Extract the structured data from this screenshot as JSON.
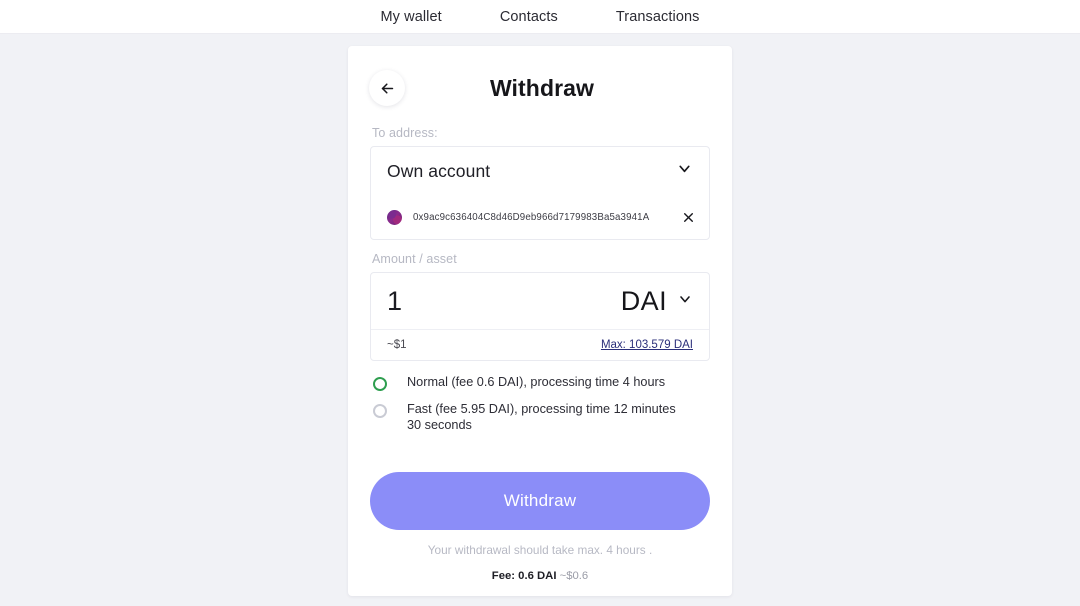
{
  "nav": {
    "items": [
      {
        "label": "My wallet"
      },
      {
        "label": "Contacts"
      },
      {
        "label": "Transactions"
      }
    ]
  },
  "card": {
    "back_icon": "arrow-left-icon",
    "title": "Withdraw",
    "to_address": {
      "label": "To address:",
      "selected": "Own account",
      "chevron_icon": "chevron-down-icon",
      "address": "0x9ac9c636404C8d46D9eb966d7179983Ba5a3941A",
      "avatar_icon": "blockie-avatar-icon",
      "clear_icon": "close-icon"
    },
    "amount": {
      "label": "Amount / asset",
      "value": "1",
      "placeholder": "0",
      "asset": "DAI",
      "asset_chevron_icon": "chevron-down-icon",
      "usd_equivalent": "~$1",
      "max_link": "Max: 103.579 DAI"
    },
    "speed_options": [
      {
        "label": "Normal (fee 0.6 DAI), processing time 4 hours",
        "selected": true
      },
      {
        "label": "Fast (fee 5.95 DAI), processing time 12 minutes 30 seconds",
        "selected": false
      }
    ],
    "submit": {
      "label": "Withdraw",
      "note": "Your withdrawal should take max. 4 hours .",
      "fee_label": "Fee: 0.6 DAI",
      "fee_approx": "~$0.6"
    }
  },
  "colors": {
    "page_bg": "#f1f2f6",
    "accent": "#8b8df8",
    "radio_selected": "#2e9e4f",
    "link": "#2b2f7a"
  }
}
